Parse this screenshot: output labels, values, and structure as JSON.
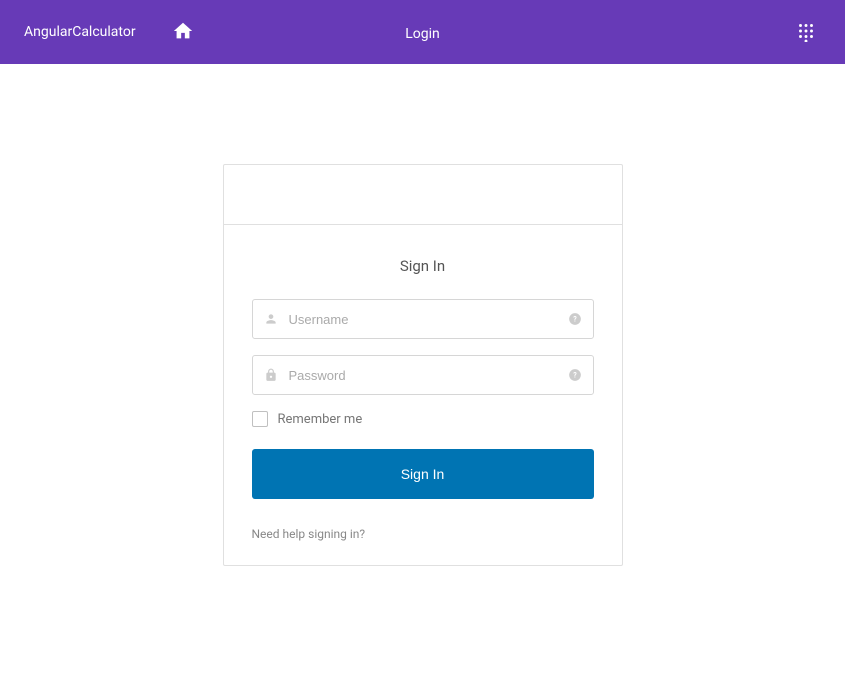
{
  "header": {
    "appTitle": "AngularCalculator",
    "loginLabel": "Login"
  },
  "login": {
    "title": "Sign In",
    "usernamePlaceholder": "Username",
    "passwordPlaceholder": "Password",
    "rememberMeLabel": "Remember me",
    "signInButton": "Sign In",
    "helpLink": "Need help signing in?"
  }
}
